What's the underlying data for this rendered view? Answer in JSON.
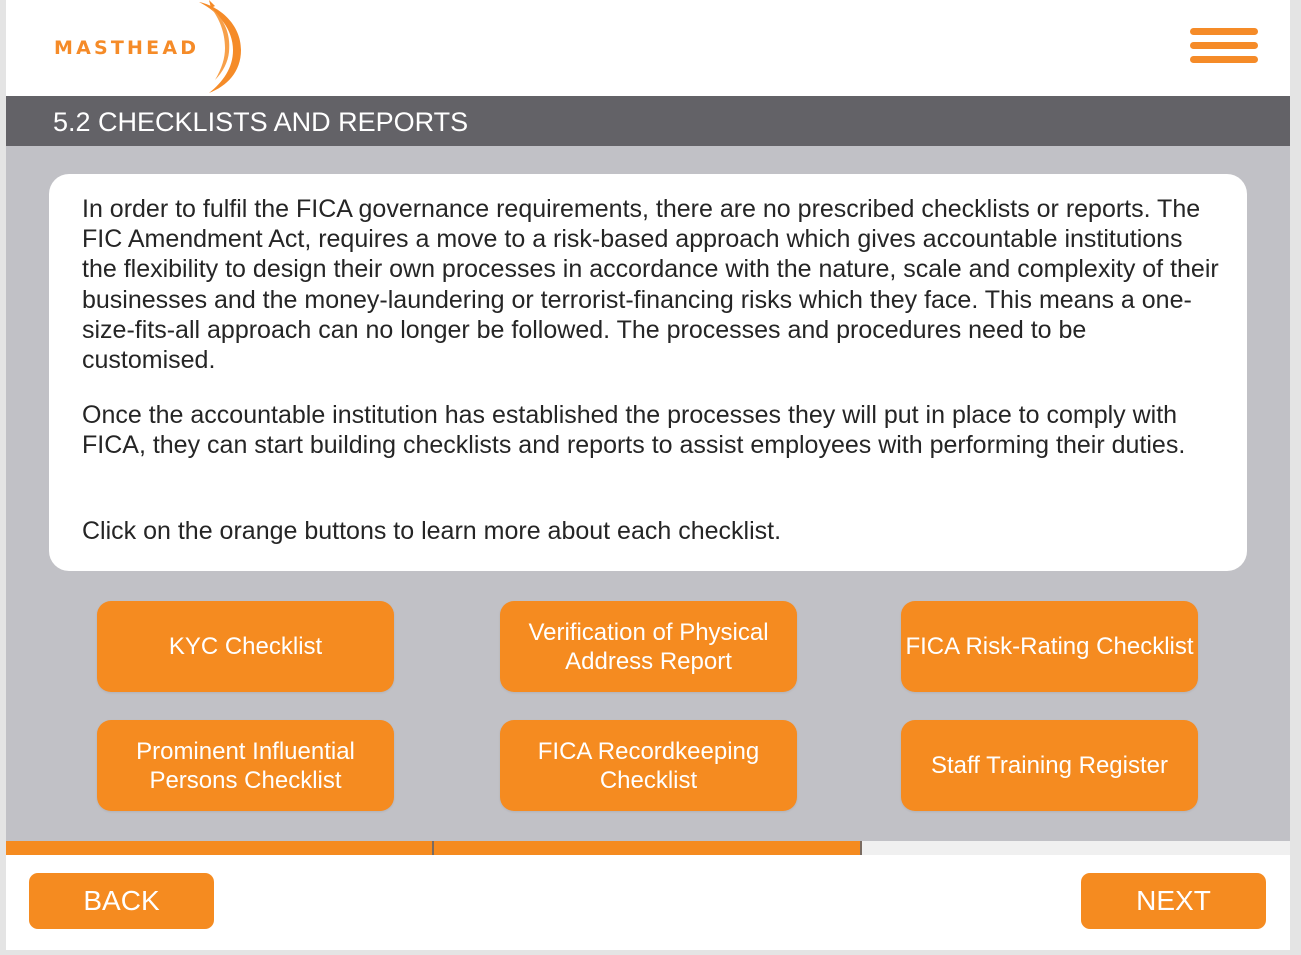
{
  "brand": {
    "name": "MASTHEAD",
    "accent_color": "#f58b20",
    "title_bar_color": "#636267"
  },
  "header": {
    "menu_icon": "hamburger-menu-icon"
  },
  "page": {
    "title": "5.2 CHECKLISTS AND REPORTS"
  },
  "content": {
    "paragraphs": [
      "In order to fulfil the FICA governance requirements, there are no prescribed checklists or reports. The FIC Amendment Act, requires a move to a risk-based approach which gives accountable institutions the flexibility to design their own processes in accordance with the nature, scale and complexity of their businesses and the money-laundering or terrorist-financing risks which they face. This means a one-size-fits-all approach can no longer be followed. The processes and procedures need to be customised.",
      "Once the accountable institution has established the processes they will put in place to comply with FICA, they can start building checklists and reports to assist employees with performing their duties.",
      "Click on the orange buttons to learn more about each checklist."
    ]
  },
  "options": [
    {
      "label": "KYC Checklist"
    },
    {
      "label": "Verification of Physical Address Report"
    },
    {
      "label": "FICA Risk-Rating Checklist"
    },
    {
      "label": "Prominent Influential Persons Checklist"
    },
    {
      "label": "FICA Recordkeeping Checklist"
    },
    {
      "label": "Staff Training Register"
    }
  ],
  "progress": {
    "completed_segments": 2,
    "total_segments": 3
  },
  "footer": {
    "back_label": "BACK",
    "next_label": "NEXT"
  }
}
